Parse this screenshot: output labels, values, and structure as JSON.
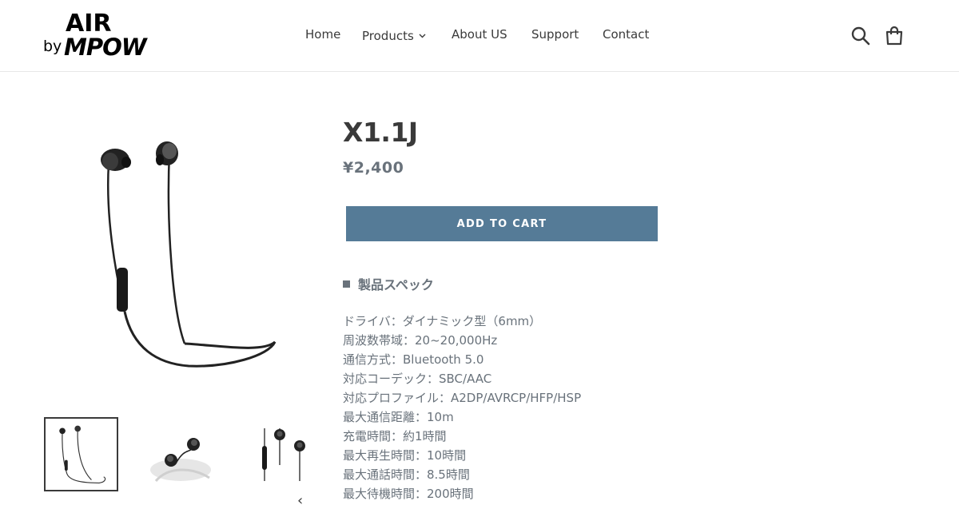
{
  "logo": {
    "top_text": "AIR",
    "by_text": "by",
    "brand_text": "MPOW"
  },
  "nav": {
    "items": [
      {
        "label": "Home"
      },
      {
        "label": "Products"
      },
      {
        "label": "About US"
      },
      {
        "label": "Support"
      },
      {
        "label": "Contact"
      }
    ]
  },
  "header_icons": [
    "search-icon",
    "cart-icon"
  ],
  "product": {
    "title": "X1.1J",
    "price": "¥2,400",
    "add_to_cart_label": "ADD TO CART",
    "spec_heading": "製品スペック",
    "specs": [
      "ドライバ：ダイナミック型（6mm）",
      "周波数帯域：20~20,000Hz",
      "通信方式：Bluetooth 5.0",
      "対応コーデック：SBC/AAC",
      "対応プロファイル：A2DP/AVRCP/HFP/HSP",
      "最大通信距離：10m",
      "充電時間：約1時間",
      "最大再生時間：10時間",
      "最大通話時間：8.5時間",
      "最大待機時間：200時間"
    ]
  },
  "gallery": {
    "thumbnail_count": 3,
    "active_index": 0
  },
  "colors": {
    "accent": "#557b97",
    "text": "#3a3a3a",
    "muted": "#69727b"
  }
}
